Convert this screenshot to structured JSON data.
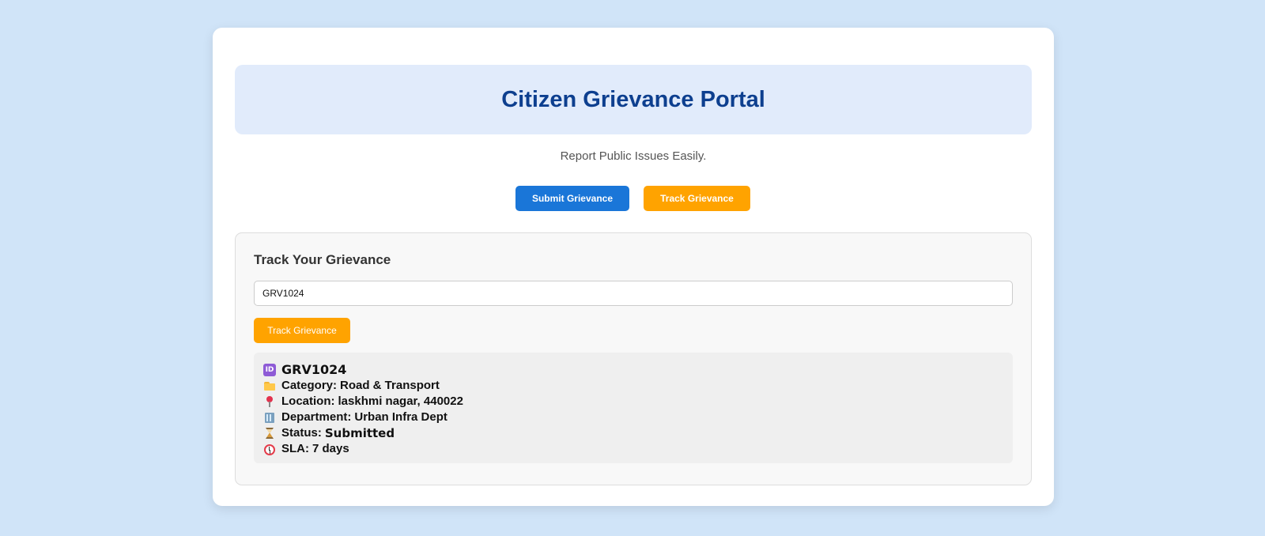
{
  "header": {
    "title": "Citizen Grievance Portal",
    "subtitle": "Report Public Issues Easily."
  },
  "actions": {
    "submit_label": "Submit Grievance",
    "track_label": "Track Grievance"
  },
  "track_panel": {
    "title": "Track Your Grievance",
    "input_value": "GRV1024",
    "button_label": "Track Grievance",
    "result": {
      "id": "GRV1024",
      "category_label": "Category:",
      "category": "Road & Transport",
      "location_label": "Location:",
      "location": "laskhmi nagar, 440022",
      "department_label": "Department:",
      "department": "Urban Infra Dept",
      "status_label": "Status:",
      "status": "Submitted",
      "sla_label": "SLA:",
      "sla": "7 days"
    }
  },
  "icons": {
    "id": "id-icon",
    "category": "folder-icon",
    "location": "pin-icon",
    "department": "building-icon",
    "status": "hourglass-icon",
    "sla": "alarm-clock-icon"
  },
  "colors": {
    "page_background": "#d0e4f8",
    "title": "#0d3f8f",
    "banner": "#e1ebfb",
    "primary_button": "#1a76d8",
    "secondary_button": "#ffa300"
  }
}
